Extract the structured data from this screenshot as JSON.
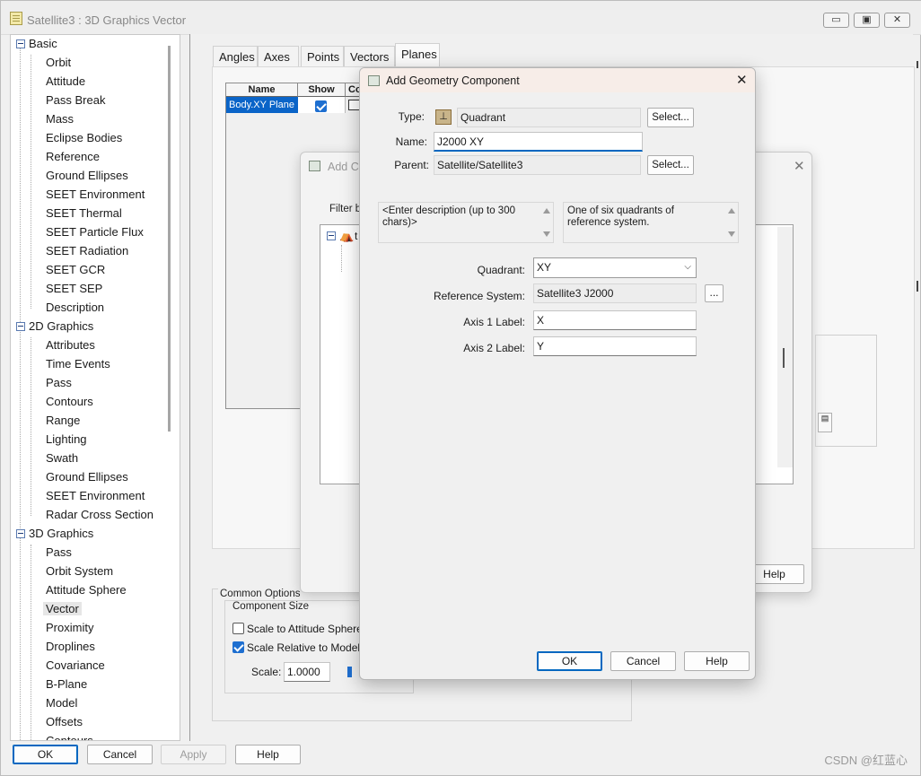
{
  "window": {
    "title": "Satellite3 : 3D Graphics Vector",
    "controls": {
      "minimize": "▭",
      "restore": "▣",
      "close": "✕"
    }
  },
  "tree": {
    "groups": [
      {
        "label": "Basic",
        "items": [
          "Orbit",
          "Attitude",
          "Pass Break",
          "Mass",
          "Eclipse Bodies",
          "Reference",
          "Ground Ellipses",
          "SEET Environment",
          "SEET Thermal",
          "SEET Particle Flux",
          "SEET Radiation",
          "SEET GCR",
          "SEET SEP",
          "Description"
        ]
      },
      {
        "label": "2D Graphics",
        "items": [
          "Attributes",
          "Time Events",
          "Pass",
          "Contours",
          "Range",
          "Lighting",
          "Swath",
          "Ground Ellipses",
          "SEET Environment",
          "Radar Cross Section"
        ]
      },
      {
        "label": "3D Graphics",
        "items": [
          "Pass",
          "Orbit System",
          "Attitude Sphere",
          "Vector",
          "Proximity",
          "Droplines",
          "Covariance",
          "B-Plane",
          "Model",
          "Offsets",
          "Contours"
        ]
      }
    ],
    "selected": "Vector"
  },
  "tabs": [
    "Angles",
    "Axes",
    "Points",
    "Vectors",
    "Planes"
  ],
  "active_tab": "Planes",
  "planes_table": {
    "columns": [
      "Name",
      "Show",
      "Co"
    ],
    "rows": [
      {
        "name": "Body.XY Plane",
        "show": true
      }
    ]
  },
  "common_options": {
    "group_label": "Common Options",
    "size_label": "Component Size",
    "scale_to_attitude_sphere": {
      "label": "Scale to Attitude Sphere",
      "checked": false
    },
    "scale_relative_to_model": {
      "label": "Scale Relative to Model",
      "checked": true
    },
    "scale_label": "Scale:",
    "scale_value": "1.0000"
  },
  "main_buttons": {
    "ok": "OK",
    "cancel": "Cancel",
    "apply": "Apply",
    "help": "Help"
  },
  "behind_dialog": {
    "title": "Add C",
    "filter_label": "Filter by",
    "tree_node": "t",
    "help": "Help"
  },
  "dialog": {
    "title": "Add Geometry Component",
    "type_label": "Type:",
    "type_value": "Quadrant",
    "name_label": "Name:",
    "name_value": "J2000 XY",
    "parent_label": "Parent:",
    "parent_value": "Satellite/Satellite3",
    "select_label": "Select...",
    "description_placeholder": "<Enter description (up to 300 chars)>",
    "type_description": "One of six quadrants of reference system.",
    "quadrant_label": "Quadrant:",
    "quadrant_value": "XY",
    "reference_system_label": "Reference System:",
    "reference_system_value": "Satellite3 J2000",
    "ellipsis": "...",
    "axis1_label": "Axis 1 Label:",
    "axis1_value": "X",
    "axis2_label": "Axis 2 Label:",
    "axis2_value": "Y",
    "ok": "OK",
    "cancel": "Cancel",
    "help": "Help",
    "close": "✕"
  },
  "watermark": "CSDN @红蓝心"
}
